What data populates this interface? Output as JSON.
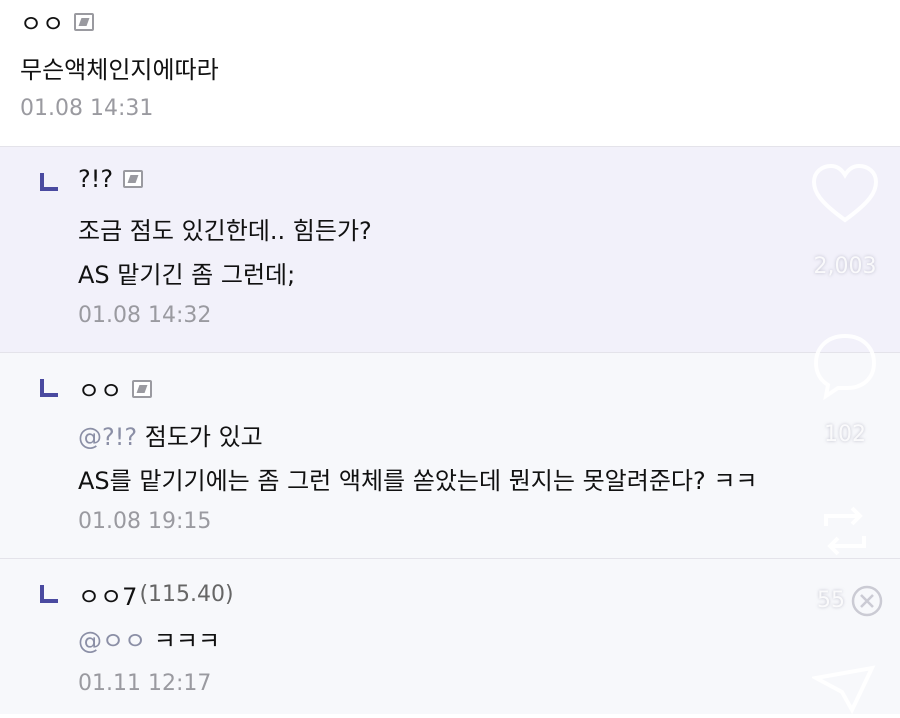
{
  "comments": [
    {
      "author": "ㅇㅇ",
      "text": "무슨액체인지에따라",
      "date": "01.08 14:31"
    },
    {
      "author": "?!?",
      "lines": [
        "조금 점도 있긴한데.. 힘든가?",
        "AS 맡기긴 좀 그런데;"
      ],
      "date": "01.08 14:32"
    },
    {
      "author": "ㅇㅇ",
      "mention": "@?!?",
      "line1_rest": " 점도가 있고",
      "line2": "AS를 맡기기에는 좀 그런 액체를 쏟았는데 뭔지는 못알려준다? ㅋㅋ",
      "date": "01.08 19:15"
    },
    {
      "author": "ㅇㅇ7",
      "author_ip": "(115.40)",
      "mention": "@ㅇㅇ",
      "text_rest": " ㅋㅋㅋ",
      "date": "01.11 12:17"
    }
  ],
  "overlay": {
    "like_count": "2,003",
    "comment_count": "102",
    "share_count": "55"
  },
  "icons": {
    "reply": "reply-arrow-icon",
    "badge": "fixed-nick-badge-icon",
    "like": "heart-icon",
    "comment": "speech-bubble-icon",
    "share": "repost-icon",
    "close": "close-circle-icon",
    "send": "send-icon"
  }
}
